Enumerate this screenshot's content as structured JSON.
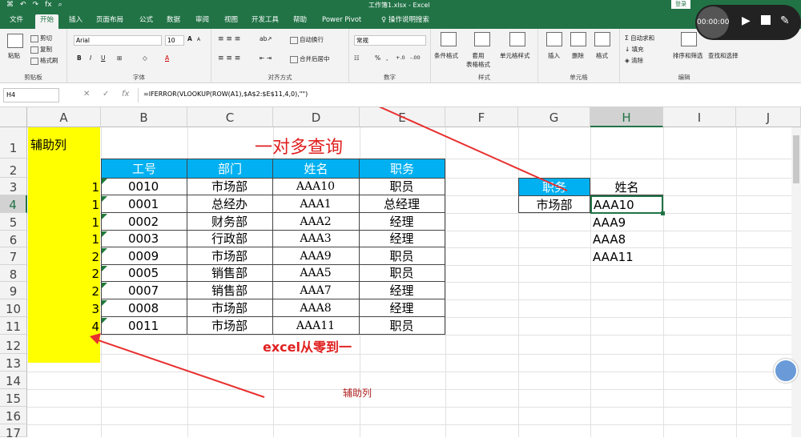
{
  "titlebar": {
    "qat": [
      "⌘",
      "↶",
      "↷",
      "fx",
      "⌕"
    ],
    "title": "工作簿1.xlsx  -  Excel",
    "login": "登录"
  },
  "tabs": [
    "文件",
    "开始",
    "插入",
    "页面布局",
    "公式",
    "数据",
    "审阅",
    "视图",
    "开发工具",
    "帮助",
    "Power Pivot",
    "操作说明搜索"
  ],
  "ribbon": {
    "clipboard": {
      "label": "剪贴板",
      "paste": "粘贴",
      "cut": "剪切",
      "copy": "复制",
      "painter": "格式刷"
    },
    "font": {
      "label": "字体",
      "name": "Arial",
      "size": "10",
      "bold": "B",
      "italic": "I",
      "underline": "U",
      "grow": "A",
      "shrink": "A"
    },
    "align": {
      "label": "对齐方式",
      "wrap": "自动换行",
      "merge": "合并后居中"
    },
    "number": {
      "label": "数字",
      "format": "常规",
      "percent": "%",
      "comma": ",",
      "inc": "+.0",
      "dec": "-.00"
    },
    "styles": {
      "label": "样式",
      "cond": "条件格式",
      "table": "套用\n表格格式",
      "cell": "单元格样式"
    },
    "cells": {
      "label": "单元格",
      "insert": "插入",
      "delete": "删除",
      "format": "格式"
    },
    "edit": {
      "label": "编辑",
      "autosum": "自动求和",
      "fill": "填充",
      "clear": "清除",
      "sort": "排序和筛选",
      "find": "查找和选择"
    }
  },
  "recorder": {
    "time": "00:00:00"
  },
  "formulabar": {
    "namebox": "H4",
    "formula": "=IFERROR(VLOOKUP(ROW(A1),$A$2:$E$11,4,0),\"\")"
  },
  "columns": [
    "A",
    "B",
    "C",
    "D",
    "E",
    "F",
    "G",
    "H",
    "I",
    "J"
  ],
  "rows": [
    "1",
    "2",
    "3",
    "4",
    "5",
    "6",
    "7",
    "8",
    "9",
    "10",
    "11",
    "12",
    "13",
    "14",
    "15",
    "16",
    "17"
  ],
  "sheet": {
    "a1": "辅助列",
    "title": "一对多查询",
    "helper": [
      "1",
      "1",
      "1",
      "1",
      "2",
      "2",
      "2",
      "3",
      "4"
    ],
    "headers": [
      "工号",
      "部门",
      "姓名",
      "职务"
    ],
    "rows": [
      [
        "0010",
        "市场部",
        "AAA10",
        "职员"
      ],
      [
        "0001",
        "总经办",
        "AAA1",
        "总经理"
      ],
      [
        "0002",
        "财务部",
        "AAA2",
        "经理"
      ],
      [
        "0003",
        "行政部",
        "AAA3",
        "经理"
      ],
      [
        "0009",
        "市场部",
        "AAA9",
        "职员"
      ],
      [
        "0005",
        "销售部",
        "AAA5",
        "职员"
      ],
      [
        "0007",
        "销售部",
        "AAA7",
        "经理"
      ],
      [
        "0008",
        "市场部",
        "AAA8",
        "经理"
      ],
      [
        "0011",
        "市场部",
        "AAA11",
        "职员"
      ]
    ],
    "lookup_header_job": "职务",
    "lookup_header_name": "姓名",
    "lookup_job": "市场部",
    "results": [
      "AAA10",
      "AAA9",
      "AAA8",
      "AAA11"
    ],
    "watermark": "excel从零到一",
    "annotation": "辅助列"
  }
}
